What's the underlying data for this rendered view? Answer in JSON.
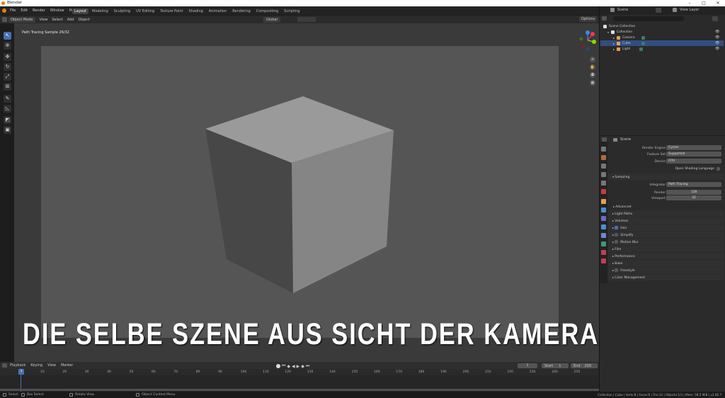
{
  "window": {
    "title": "Blender",
    "minimize": "–",
    "maximize": "□",
    "close": "✕"
  },
  "menu": [
    "File",
    "Edit",
    "Render",
    "Window",
    "Help"
  ],
  "workspaces": [
    "Layout",
    "Modeling",
    "Sculpting",
    "UV Editing",
    "Texture Paint",
    "Shading",
    "Animation",
    "Rendering",
    "Compositing",
    "Scripting"
  ],
  "active_workspace": "Layout",
  "scene": {
    "label": "Scene",
    "view_layer": "View Layer"
  },
  "viewport_header": {
    "mode": "Object Mode",
    "view": "View",
    "select": "Select",
    "add": "Add",
    "object": "Object",
    "orientation": "Global",
    "options": "Options"
  },
  "viewport": {
    "overlay_text": "Path Tracing Sample 26/32"
  },
  "caption": "DIE SELBE SZENE AUS SICHT DER KAMERA",
  "tools": [
    "select",
    "cursor",
    "move",
    "rotate",
    "scale",
    "transform",
    "annotate",
    "measure",
    "add-cube",
    "add-object"
  ],
  "outliner": {
    "title": "Scene Collection",
    "items": [
      {
        "label": "Collection"
      },
      {
        "label": "Camera"
      },
      {
        "label": "Cube"
      },
      {
        "label": "Light"
      }
    ]
  },
  "properties": {
    "header": "Scene",
    "render_engine_label": "Render Engine",
    "render_engine": "Cycles",
    "feature_set_label": "Feature Set",
    "feature_set": "Supported",
    "device_label": "Device",
    "device": "CPU",
    "osl_label": "Open Shading Language",
    "sampling": "Sampling",
    "integrator_label": "Integrator",
    "integrator": "Path Tracing",
    "render_label": "Render",
    "render_value": "128",
    "viewport_label": "Viewport",
    "viewport_value": "32",
    "advanced": "Advanced",
    "panels": [
      "Light Paths",
      "Volumes",
      "Hair",
      "Simplify",
      "Motion Blur",
      "Film",
      "Performance",
      "Bake",
      "Freestyle",
      "Color Management"
    ]
  },
  "timeline": {
    "menus": [
      "Playback",
      "Keying",
      "View",
      "Marker"
    ],
    "current_frame": "1",
    "start_label": "Start",
    "start": "1",
    "end_label": "End",
    "end": "250",
    "ticks": [
      "10",
      "20",
      "30",
      "40",
      "50",
      "60",
      "70",
      "80",
      "90",
      "100",
      "110",
      "120",
      "130",
      "140",
      "150",
      "160",
      "170",
      "180",
      "190",
      "200",
      "210",
      "220",
      "230",
      "240",
      "250"
    ]
  },
  "statusbar": {
    "select": "Select",
    "box_select": "Box Select",
    "rotate_view": "Rotate View",
    "context_menu": "Object Context Menu",
    "stats": "Collection | Cube | Verts:8 | Faces:6 | Tris:12 | Objects:1/3 | Mem: 58.5 MiB | v2.82.7"
  }
}
